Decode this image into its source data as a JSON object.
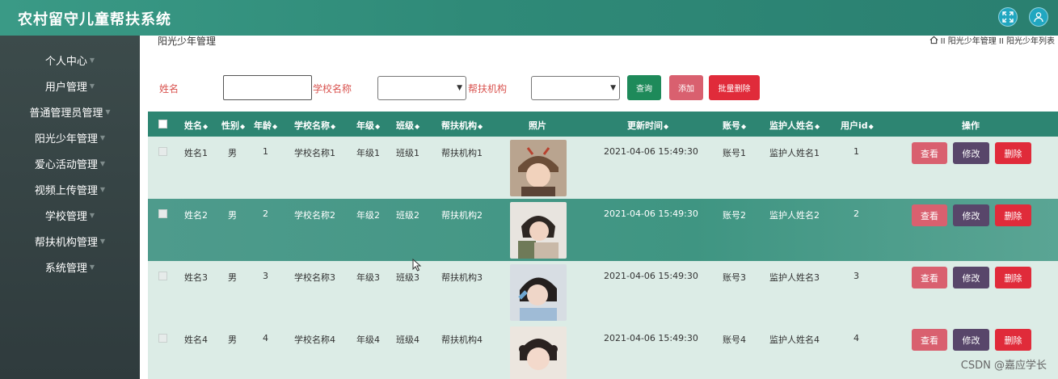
{
  "app": {
    "title": "农村留守儿童帮扶系统"
  },
  "header": {
    "fullscreen_icon": "expand-icon",
    "user_icon": "user-icon"
  },
  "sidebar": {
    "items": [
      {
        "label": "个人中心"
      },
      {
        "label": "用户管理"
      },
      {
        "label": "普通管理员管理"
      },
      {
        "label": "阳光少年管理"
      },
      {
        "label": "爱心活动管理"
      },
      {
        "label": "视频上传管理"
      },
      {
        "label": "学校管理"
      },
      {
        "label": "帮扶机构管理"
      },
      {
        "label": "系统管理"
      }
    ]
  },
  "page": {
    "title": "阳光少年管理"
  },
  "breadcrumb": {
    "text": "II 阳光少年管理 II 阳光少年列表"
  },
  "search": {
    "name_label": "姓名",
    "name_value": "",
    "school_label": "学校名称",
    "school_value": "",
    "org_label": "帮扶机构",
    "org_value": "",
    "query_button": "查询",
    "add_button": "添加",
    "batch_delete_button": "批量删除"
  },
  "colors": {
    "header": "#2f8a78",
    "sidebar": "#354344",
    "table_header": "#2d8572",
    "view": "#d9606f",
    "edit": "#58466a",
    "delete": "#e02b3a",
    "query": "#1e8a5a"
  },
  "table": {
    "columns": [
      "姓名",
      "性别",
      "年龄",
      "学校名称",
      "年级",
      "班级",
      "帮扶机构",
      "照片",
      "更新时间",
      "账号",
      "监护人姓名",
      "用户id",
      "操作"
    ],
    "sort_icon": "sort-icon",
    "rows": [
      {
        "name": "姓名1",
        "gender": "男",
        "age": "1",
        "school": "学校名称1",
        "grade": "年级1",
        "class": "班级1",
        "org": "帮扶机构1",
        "time": "2021-04-06 15:49:30",
        "account": "账号1",
        "guardian": "监护人姓名1",
        "uid": "1"
      },
      {
        "name": "姓名2",
        "gender": "男",
        "age": "2",
        "school": "学校名称2",
        "grade": "年级2",
        "class": "班级2",
        "org": "帮扶机构2",
        "time": "2021-04-06 15:49:30",
        "account": "账号2",
        "guardian": "监护人姓名2",
        "uid": "2"
      },
      {
        "name": "姓名3",
        "gender": "男",
        "age": "3",
        "school": "学校名称3",
        "grade": "年级3",
        "class": "班级3",
        "org": "帮扶机构3",
        "time": "2021-04-06 15:49:30",
        "account": "账号3",
        "guardian": "监护人姓名3",
        "uid": "3"
      },
      {
        "name": "姓名4",
        "gender": "男",
        "age": "4",
        "school": "学校名称4",
        "grade": "年级4",
        "class": "班级4",
        "org": "帮扶机构4",
        "time": "2021-04-06 15:49:30",
        "account": "账号4",
        "guardian": "监护人姓名4",
        "uid": "4"
      }
    ],
    "actions": {
      "view": "查看",
      "edit": "修改",
      "delete": "删除"
    }
  },
  "watermark": "CSDN @嘉应学长"
}
